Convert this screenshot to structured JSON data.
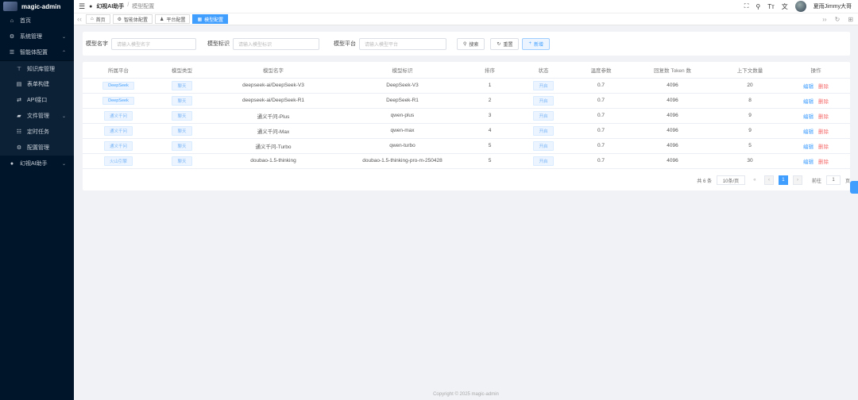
{
  "app": {
    "name": "magic-admin"
  },
  "sidebar": {
    "items": [
      {
        "label": "首页",
        "icon": "home-icon"
      },
      {
        "label": "系统管理",
        "icon": "gear-icon"
      },
      {
        "label": "智能体配置",
        "icon": "menu-icon"
      },
      {
        "label": "知识库管理",
        "icon": "book-icon"
      },
      {
        "label": "表单构建",
        "icon": "form-icon"
      },
      {
        "label": "API接口",
        "icon": "api-icon"
      },
      {
        "label": "文件管理",
        "icon": "folder-icon"
      },
      {
        "label": "定时任务",
        "icon": "list-icon"
      },
      {
        "label": "配置管理",
        "icon": "config-icon"
      },
      {
        "label": "幻视AI助手",
        "icon": "apple-icon"
      }
    ]
  },
  "topbar": {
    "breadcrumb": [
      "幻视AI助手",
      "模型配置"
    ],
    "user": "夏雨Jimmy大哥"
  },
  "tabs": [
    {
      "label": "首页",
      "icon": "home-icon"
    },
    {
      "label": "智能体配置",
      "icon": "gear-icon"
    },
    {
      "label": "平台配置",
      "icon": "user-icon"
    },
    {
      "label": "模型配置",
      "icon": "grid-icon"
    }
  ],
  "filter": {
    "model_name_label": "模型名字",
    "model_name_placeholder": "请输入模型名字",
    "model_id_label": "模型标识",
    "model_id_placeholder": "请输入模型标识",
    "platform_label": "模型平台",
    "platform_placeholder": "请输入模型平台",
    "search_label": "搜索",
    "reset_label": "重置",
    "add_label": "新增"
  },
  "table": {
    "headers": [
      "所属平台",
      "模型类型",
      "模型名字",
      "模型标识",
      "排序",
      "状态",
      "温度参数",
      "回复数 Token 数",
      "上下文数量",
      "操作"
    ],
    "rows": [
      {
        "platform": "DeepSeek",
        "type": "聊天",
        "name": "deepseek-ai/DeepSeek-V3",
        "id": "DeepSeek-V3",
        "sort": "1",
        "status": "开启",
        "temp": "0.7",
        "tokens": "4096",
        "context": "20"
      },
      {
        "platform": "DeepSeek",
        "type": "聊天",
        "name": "deepseek-ai/DeepSeek-R1",
        "id": "DeepSeek-R1",
        "sort": "2",
        "status": "开启",
        "temp": "0.7",
        "tokens": "4096",
        "context": "8"
      },
      {
        "platform": "通义千问",
        "type": "聊天",
        "name": "通义千问-Plus",
        "id": "qwen-plus",
        "sort": "3",
        "status": "开启",
        "temp": "0.7",
        "tokens": "4096",
        "context": "9"
      },
      {
        "platform": "通义千问",
        "type": "聊天",
        "name": "通义千问-Max",
        "id": "qwen-max",
        "sort": "4",
        "status": "开启",
        "temp": "0.7",
        "tokens": "4096",
        "context": "9"
      },
      {
        "platform": "通义千问",
        "type": "聊天",
        "name": "通义千问-Turbo",
        "id": "qwen-turbo",
        "sort": "5",
        "status": "开启",
        "temp": "0.7",
        "tokens": "4096",
        "context": "5"
      },
      {
        "platform": "火山引擎",
        "type": "聊天",
        "name": "doubao-1.5-thinking",
        "id": "doubao-1.5-thinking-pro-m-250428",
        "sort": "5",
        "status": "开启",
        "temp": "0.7",
        "tokens": "4096",
        "context": "30"
      }
    ],
    "edit_label": "编辑",
    "delete_label": "删除"
  },
  "pagination": {
    "total": "共 6 条",
    "page_size": "10条/页",
    "current": "1",
    "goto_label": "前往",
    "goto_value": "1",
    "page_unit": "页"
  },
  "footer": "Copyright © 2025 magic-admin",
  "colors": {
    "sidebar": "#001529",
    "primary": "#409eff",
    "danger": "#f56c6c"
  }
}
